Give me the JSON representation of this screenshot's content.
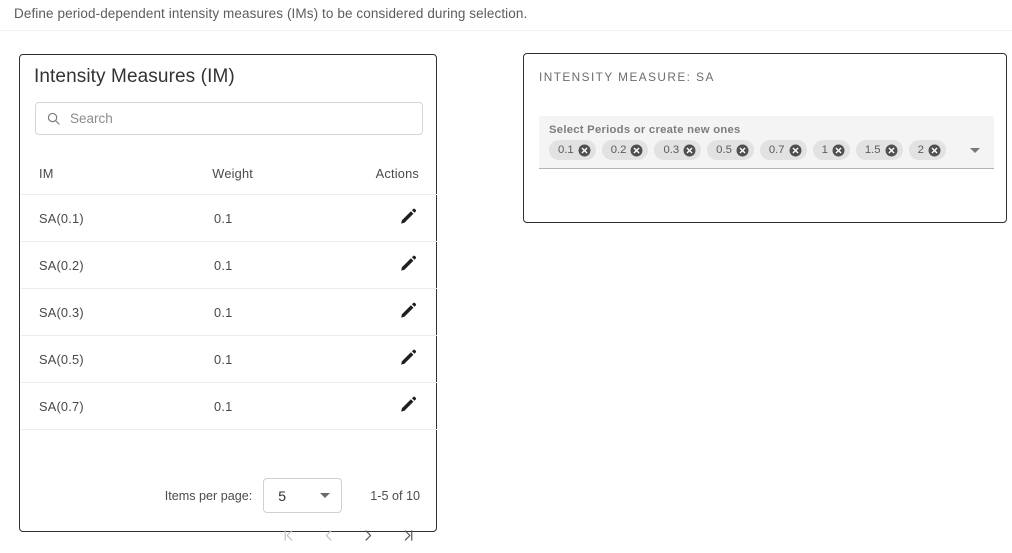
{
  "page": {
    "description": "Define period-dependent intensity measures (IMs) to be considered during selection."
  },
  "im_card": {
    "title": "Intensity Measures (IM)",
    "search": {
      "placeholder": "Search",
      "value": "",
      "icon": "search-icon"
    },
    "table": {
      "columns": [
        "IM",
        "Weight",
        "Actions"
      ],
      "rows": [
        {
          "im": "SA(0.1)",
          "weight": "0.1",
          "action_icon": "pencil-icon"
        },
        {
          "im": "SA(0.2)",
          "weight": "0.1",
          "action_icon": "pencil-icon"
        },
        {
          "im": "SA(0.3)",
          "weight": "0.1",
          "action_icon": "pencil-icon"
        },
        {
          "im": "SA(0.5)",
          "weight": "0.1",
          "action_icon": "pencil-icon"
        },
        {
          "im": "SA(0.7)",
          "weight": "0.1",
          "action_icon": "pencil-icon"
        }
      ]
    },
    "paginator": {
      "items_per_page_label": "Items per page:",
      "items_per_page_value": "5",
      "range_label": "1-5 of 10",
      "buttons": [
        {
          "name": "first-page-button",
          "glyph": "|<",
          "disabled": true
        },
        {
          "name": "previous-page-button",
          "glyph": "<",
          "disabled": true
        },
        {
          "name": "next-page-button",
          "glyph": ">",
          "disabled": false
        },
        {
          "name": "last-page-button",
          "glyph": ">|",
          "disabled": false
        }
      ]
    }
  },
  "sa_card": {
    "title": "INTENSITY MEASURE: SA",
    "periods_field": {
      "label": "Select Periods or create new ones",
      "chips": [
        "0.1",
        "0.2",
        "0.3",
        "0.5",
        "0.7",
        "1",
        "1.5",
        "2"
      ],
      "dropdown_icon": "chevron-down-icon"
    }
  },
  "colors": {
    "card_border": "#303030",
    "divider": "#ececec",
    "chip_bg": "#e2e2e2",
    "chip_remove": "#4f4f4f",
    "field_bg": "#f4f4f4",
    "text": "#484848",
    "muted_text": "#8b8b8b"
  }
}
